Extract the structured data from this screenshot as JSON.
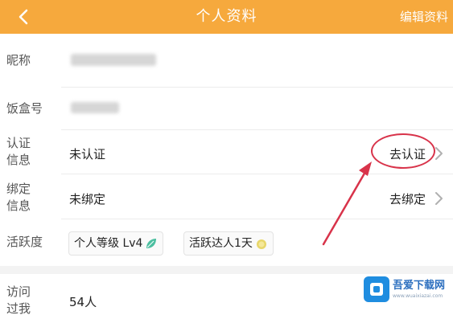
{
  "header": {
    "title": "个人资料",
    "edit_label": "编辑资料",
    "bg_color": "#f6a93d",
    "back_icon": "chevron-left-icon"
  },
  "profile": {
    "nickname_label": "昵称",
    "box_id_label": "饭盒号",
    "cert": {
      "label_line1": "认证",
      "label_line2": "信息",
      "status": "未认证",
      "action": "去认证"
    },
    "bind": {
      "label_line1": "绑定",
      "label_line2": "信息",
      "status": "未绑定",
      "action": "去绑定"
    },
    "activity": {
      "label": "活跃度",
      "tags": [
        "个人等级 Lv4",
        "活跃达人1天"
      ]
    },
    "visitors": {
      "label_line1": "访问",
      "label_line2": "过我",
      "value": "54人"
    }
  },
  "annotation": {
    "color": "#d8334a"
  },
  "watermark": {
    "title": "吾爱下载网",
    "subtitle": "www.wuaixiazai.com"
  }
}
